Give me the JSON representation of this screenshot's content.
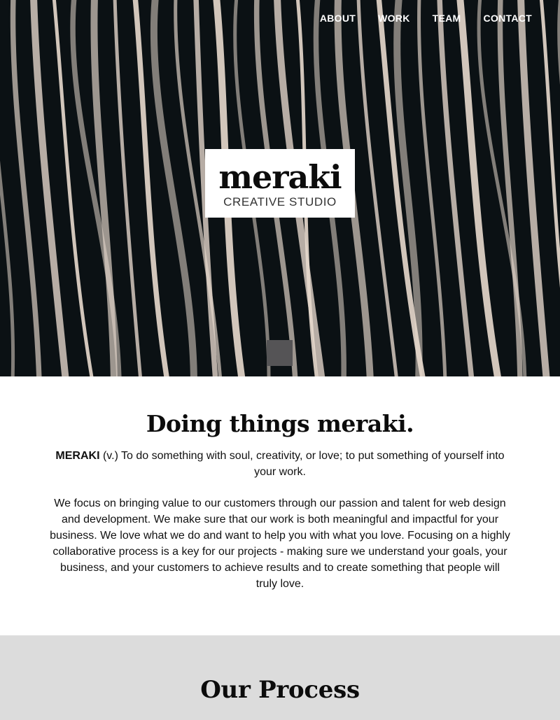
{
  "nav": {
    "items": [
      {
        "label": "ABOUT"
      },
      {
        "label": "WORK"
      },
      {
        "label": "TEAM"
      },
      {
        "label": "CONTACT"
      }
    ]
  },
  "hero": {
    "logo_word": "meraki",
    "logo_sub": "CREATIVE STUDIO",
    "scroll_icon": "square-button-icon"
  },
  "intro": {
    "heading": "Doing things meraki.",
    "term": "MERAKI",
    "definition": " (v.) To do something with soul, creativity, or love; to put something of yourself into your work.",
    "description": "We focus on bringing value to our customers through our passion and talent for web design and development. We make sure that our work is both meaningful and impactful for your business. We love what we do and want to help you with what you love. Focusing on a highly collaborative process is a key for our projects - making sure we understand your goals, your business, and your customers to achieve results and to create something that people will truly love."
  },
  "process": {
    "heading": "Our Process"
  },
  "colors": {
    "hero_dark": "#0b1114",
    "stripe": "#e6d8cc",
    "process_bg": "#dcdcdc",
    "scroll_button": "#555456"
  }
}
